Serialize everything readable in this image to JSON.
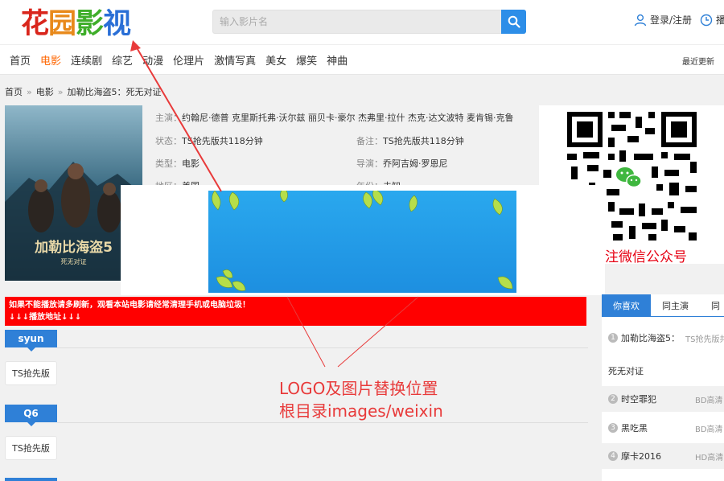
{
  "header": {
    "logo_chars": [
      "花",
      "园",
      "影",
      "视"
    ],
    "logo_colors": [
      "#d9261c",
      "#e8891b",
      "#3fae2a",
      "#2a6fd6"
    ],
    "search_placeholder": "输入影片名",
    "login_label": "登录/注册",
    "history_label": "播"
  },
  "nav": {
    "items": [
      "首页",
      "电影",
      "连续剧",
      "综艺",
      "动漫",
      "伦理片",
      "激情写真",
      "美女",
      "爆笑",
      "神曲"
    ],
    "active_index": 1,
    "right_label": "最近更新"
  },
  "breadcrumb": {
    "home": "首页",
    "separator": "»",
    "category": "电影",
    "current": "加勒比海盗5：死无对证"
  },
  "movie": {
    "poster_title": "加勒比海盗5",
    "poster_subtitle": "死无对证",
    "cast_label": "主演：",
    "cast_value": "约翰尼·德普 克里斯托弗·沃尔兹 丽贝卡·豪尔 杰弗里·拉什 杰克·达文波特 麦肯锡·克鲁",
    "status_label": "状态：",
    "status_value": "TS抢先版共118分钟",
    "remark_label": "备注：",
    "remark_value": "TS抢先版共118分钟",
    "type_label": "类型：",
    "type_value": "电影",
    "director_label": "导演：",
    "director_value": "乔阿吉姆·罗恩尼",
    "region_label": "地区：",
    "region_value": "美国",
    "year_label": "年份：",
    "year_value": "未知"
  },
  "qr": {
    "caption": "注微信公众号"
  },
  "notice": {
    "line1": "如果不能播放请多刷新，观看本站电影请经常清理手机或电脑垃圾！",
    "line2": "↓↓↓播放地址↓↓↓"
  },
  "sources": [
    {
      "name": "syun",
      "episode": "TS抢先版"
    },
    {
      "name": "Q6",
      "episode": "TS抢先版"
    }
  ],
  "annotation": {
    "line1": "LOGO及图片替换位置",
    "line2": "根目录images/weixin"
  },
  "sidebar": {
    "tabs": [
      "你喜欢",
      "同主演",
      "同"
    ],
    "items": [
      {
        "num": "1",
        "title": "加勒比海盗5：",
        "tag": "TS抢先版共"
      },
      {
        "num": "",
        "title": "死无对证",
        "tag": ""
      },
      {
        "num": "2",
        "title": "时空罪犯",
        "tag": "BD高清"
      },
      {
        "num": "3",
        "title": "黑吃黑",
        "tag": "BD高清"
      },
      {
        "num": "4",
        "title": "摩卡2016",
        "tag": "HD高清"
      }
    ]
  },
  "colors": {
    "accent_blue": "#2f80d7",
    "nav_active": "#ff6600",
    "notice_red": "#ff0000",
    "annotation_red": "#e83a3a"
  }
}
